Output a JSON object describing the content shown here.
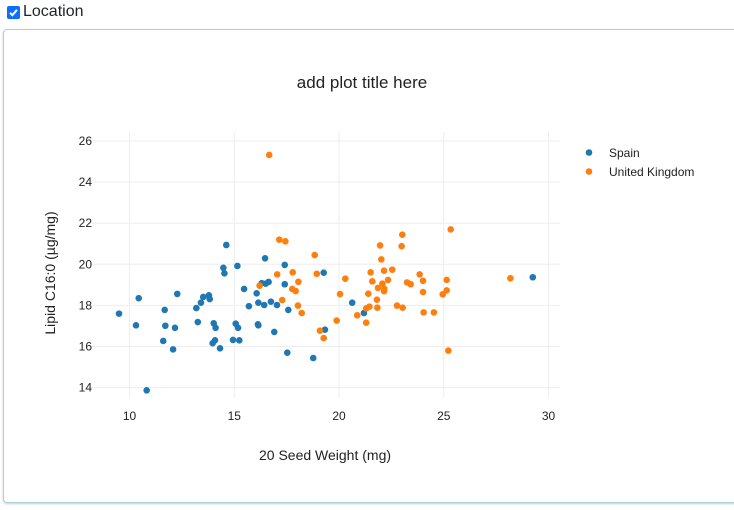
{
  "header": {
    "checkbox_label": "Location",
    "checked": true
  },
  "chart_data": {
    "type": "scatter",
    "title": "add plot title here",
    "xlabel": "20  Seed  Weight (mg)",
    "ylabel": "Lipid  C16:0 (µg/mg)",
    "xlim": [
      8.5,
      30.5
    ],
    "ylim": [
      13.3,
      26.4
    ],
    "xticks": [
      10,
      15,
      20,
      25,
      30
    ],
    "yticks": [
      14,
      16,
      18,
      20,
      22,
      24,
      26
    ],
    "grid": true,
    "legend_position": "top-right",
    "series": [
      {
        "name": "Spain",
        "color": "#1f77b4",
        "points": [
          [
            9.5,
            17.6
          ],
          [
            10.44,
            18.35
          ],
          [
            10.31,
            17.03
          ],
          [
            10.82,
            13.87
          ],
          [
            11.68,
            17.78
          ],
          [
            11.71,
            17.01
          ],
          [
            11.61,
            16.27
          ],
          [
            12.08,
            15.86
          ],
          [
            12.17,
            16.91
          ],
          [
            12.28,
            18.56
          ],
          [
            13.19,
            17.87
          ],
          [
            13.41,
            18.13
          ],
          [
            13.52,
            18.41
          ],
          [
            13.79,
            18.49
          ],
          [
            13.83,
            18.31
          ],
          [
            13.26,
            17.19
          ],
          [
            14.02,
            17.13
          ],
          [
            14.11,
            16.91
          ],
          [
            14.08,
            16.3
          ],
          [
            13.97,
            16.16
          ],
          [
            14.32,
            15.91
          ],
          [
            14.48,
            19.83
          ],
          [
            14.53,
            19.56
          ],
          [
            14.62,
            20.94
          ],
          [
            15.15,
            19.92
          ],
          [
            15.47,
            18.8
          ],
          [
            15.7,
            17.96
          ],
          [
            15.07,
            17.11
          ],
          [
            15.18,
            16.91
          ],
          [
            14.94,
            16.32
          ],
          [
            15.24,
            16.3
          ],
          [
            16.47,
            20.29
          ],
          [
            17.41,
            19.97
          ],
          [
            19.27,
            19.59
          ],
          [
            16.07,
            18.59
          ],
          [
            16.31,
            19.08
          ],
          [
            16.5,
            19.06
          ],
          [
            16.64,
            19.14
          ],
          [
            17.41,
            19.03
          ],
          [
            16.15,
            18.13
          ],
          [
            16.43,
            18.02
          ],
          [
            16.75,
            18.18
          ],
          [
            17.04,
            18.02
          ],
          [
            17.58,
            17.78
          ],
          [
            16.13,
            17.08
          ],
          [
            16.15,
            17.03
          ],
          [
            16.91,
            16.71
          ],
          [
            17.53,
            15.7
          ],
          [
            18.77,
            15.44
          ],
          [
            20.63,
            18.13
          ],
          [
            19.33,
            16.82
          ],
          [
            21.19,
            17.63
          ],
          [
            29.25,
            19.37
          ]
        ]
      },
      {
        "name": "United Kingdom",
        "color": "#ff7f0e",
        "points": [
          [
            16.67,
            25.32
          ],
          [
            17.15,
            21.2
          ],
          [
            17.44,
            21.12
          ],
          [
            18.84,
            20.45
          ],
          [
            17.05,
            19.51
          ],
          [
            17.79,
            19.61
          ],
          [
            18.94,
            19.54
          ],
          [
            20.3,
            19.3
          ],
          [
            16.21,
            18.96
          ],
          [
            18.06,
            19.15
          ],
          [
            17.77,
            18.8
          ],
          [
            17.93,
            18.7
          ],
          [
            20.05,
            18.55
          ],
          [
            17.29,
            18.26
          ],
          [
            18.04,
            17.99
          ],
          [
            18.22,
            17.63
          ],
          [
            19.89,
            17.26
          ],
          [
            19.09,
            16.77
          ],
          [
            19.27,
            16.41
          ],
          [
            20.87,
            17.52
          ],
          [
            23.02,
            21.44
          ],
          [
            25.33,
            21.7
          ],
          [
            21.96,
            20.92
          ],
          [
            22.99,
            20.88
          ],
          [
            22.02,
            20.24
          ],
          [
            21.51,
            19.61
          ],
          [
            22.15,
            19.69
          ],
          [
            22.54,
            19.74
          ],
          [
            23.85,
            19.51
          ],
          [
            21.59,
            19.17
          ],
          [
            22.34,
            19.24
          ],
          [
            22.07,
            19.06
          ],
          [
            23.25,
            19.12
          ],
          [
            23.42,
            19.03
          ],
          [
            24.01,
            19.2
          ],
          [
            25.14,
            19.24
          ],
          [
            21.86,
            18.85
          ],
          [
            22.16,
            18.81
          ],
          [
            22.15,
            18.69
          ],
          [
            21.4,
            18.57
          ],
          [
            24.01,
            18.65
          ],
          [
            25.14,
            18.73
          ],
          [
            24.95,
            18.54
          ],
          [
            21.81,
            18.28
          ],
          [
            22.77,
            17.99
          ],
          [
            23.04,
            17.89
          ],
          [
            21.45,
            17.94
          ],
          [
            21.83,
            17.89
          ],
          [
            21.3,
            17.86
          ],
          [
            24.04,
            17.66
          ],
          [
            24.53,
            17.66
          ],
          [
            21.3,
            17.16
          ],
          [
            25.22,
            15.8
          ],
          [
            28.18,
            19.32
          ]
        ]
      }
    ]
  }
}
